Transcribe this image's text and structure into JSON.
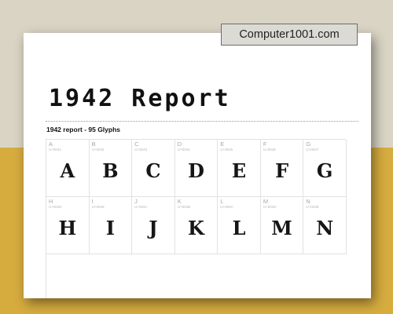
{
  "site_tag": "Computer1001.com",
  "title": "1942 Report",
  "subtitle": "1942 report - 95 Glyphs",
  "glyphs": [
    {
      "label": "A",
      "code": "U+0041",
      "glyph": "A"
    },
    {
      "label": "B",
      "code": "U+0042",
      "glyph": "B"
    },
    {
      "label": "C",
      "code": "U+0043",
      "glyph": "C"
    },
    {
      "label": "D",
      "code": "U+0044",
      "glyph": "D"
    },
    {
      "label": "E",
      "code": "U+0045",
      "glyph": "E"
    },
    {
      "label": "F",
      "code": "U+0046",
      "glyph": "F"
    },
    {
      "label": "G",
      "code": "U+0047",
      "glyph": "G"
    },
    {
      "label": "H",
      "code": "U+0048",
      "glyph": "H"
    },
    {
      "label": "I",
      "code": "U+0049",
      "glyph": "I"
    },
    {
      "label": "J",
      "code": "U+004A",
      "glyph": "J"
    },
    {
      "label": "K",
      "code": "U+004B",
      "glyph": "K"
    },
    {
      "label": "L",
      "code": "U+004C",
      "glyph": "L"
    },
    {
      "label": "M",
      "code": "U+004D",
      "glyph": "M"
    },
    {
      "label": "N",
      "code": "U+004E",
      "glyph": "N"
    }
  ]
}
